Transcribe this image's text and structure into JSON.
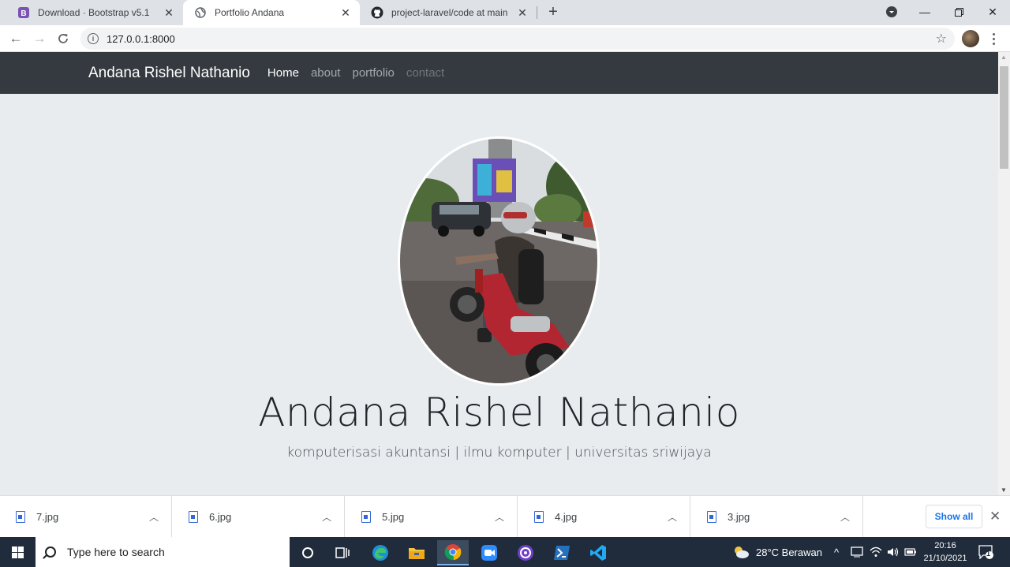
{
  "browser": {
    "tabs": [
      {
        "title": "Download · Bootstrap v5.1",
        "icon": "bootstrap-icon",
        "active": false
      },
      {
        "title": "Portfolio Andana",
        "icon": "globe-icon",
        "active": true
      },
      {
        "title": "project-laravel/code at main · An",
        "icon": "github-icon",
        "active": false
      }
    ],
    "url": "127.0.0.1:8000"
  },
  "page": {
    "brand": "Andana Rishel Nathanio",
    "nav": [
      "Home",
      "about",
      "portfolio",
      "contact"
    ],
    "heading": "Andana Rishel Nathanio",
    "lead": "komputerisasi akuntansi | ilmu komputer | universitas sriwijaya"
  },
  "downloads": {
    "files": [
      "7.jpg",
      "6.jpg",
      "5.jpg",
      "4.jpg",
      "3.jpg"
    ],
    "show_all": "Show all"
  },
  "taskbar": {
    "search_placeholder": "Type here to search",
    "weather": "28°C Berawan",
    "time": "20:16",
    "date": "21/10/2021",
    "notification_count": "1"
  },
  "colors": {
    "navbar_bg": "#343a40",
    "page_bg": "#e9ecef",
    "taskbar_bg": "#202c3c",
    "accent": "#1a73e8"
  }
}
